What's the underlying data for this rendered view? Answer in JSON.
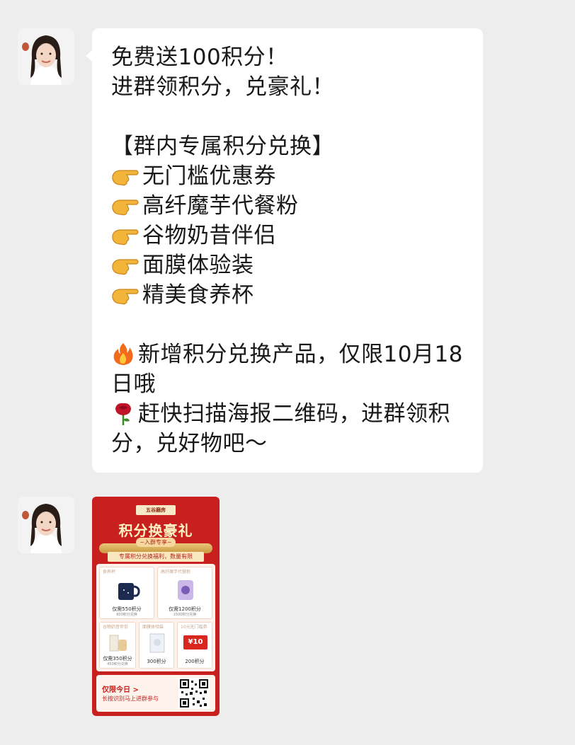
{
  "message1": {
    "lines": [
      "免费送100积分！",
      "进群领积分，兑豪礼！",
      "",
      "【群内专属积分兑换】",
      "无门槛优惠券",
      "高纤魔芋代餐粉",
      "谷物奶昔伴侣",
      "面膜体验装",
      "精美食养杯",
      "",
      "新增积分兑换产品，仅限10月18日哦",
      "赶快扫描海报二维码，进群领积分，兑好物吧～"
    ],
    "emoji": {
      "pointing": "backhand-index-pointing-right",
      "fire": "fire",
      "rose": "rose"
    }
  },
  "poster": {
    "brand": "五谷磨房",
    "title": "积分换豪礼",
    "subtitle": "~入群专享~",
    "banner": "专属积分兑换福利，数量有限",
    "items": [
      {
        "tag": "食养杯",
        "price": "仅需550积分",
        "note": "800积分兑换"
      },
      {
        "tag": "高纤魔芋代餐粉",
        "price": "仅需1200积分",
        "note": "1500积分兑换"
      },
      {
        "tag": "谷物奶昔伴侣",
        "price": "仅需350积分",
        "note": "450积分兑换"
      },
      {
        "tag": "面膜体验装",
        "price": "300积分",
        "note": ""
      },
      {
        "tag": "10元无门槛券",
        "price": "200积分",
        "note": ""
      }
    ],
    "coupon_value": "¥10",
    "footer_line1": "仅限今日 >",
    "footer_line2": "长按识别马上进群参与"
  },
  "colors": {
    "background": "#ededed",
    "bubble": "#ffffff",
    "poster_red": "#c8201e",
    "poster_gold": "#fff2c4"
  }
}
